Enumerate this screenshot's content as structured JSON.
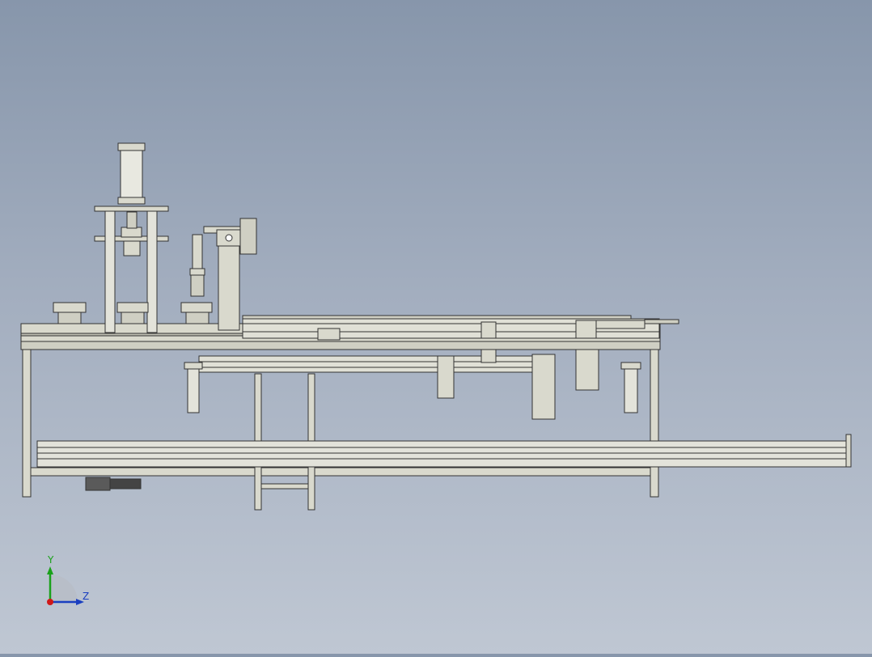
{
  "viewport": {
    "background_top": "#8796ab",
    "background_bottom": "#bfc7d3",
    "model_fill": "#d9d9cd",
    "model_stroke": "#333333"
  },
  "triad": {
    "y_label": "Y",
    "z_label": "Z",
    "y_color": "#1aa11a",
    "z_color": "#1a3fc0",
    "origin_color": "#d01818"
  }
}
